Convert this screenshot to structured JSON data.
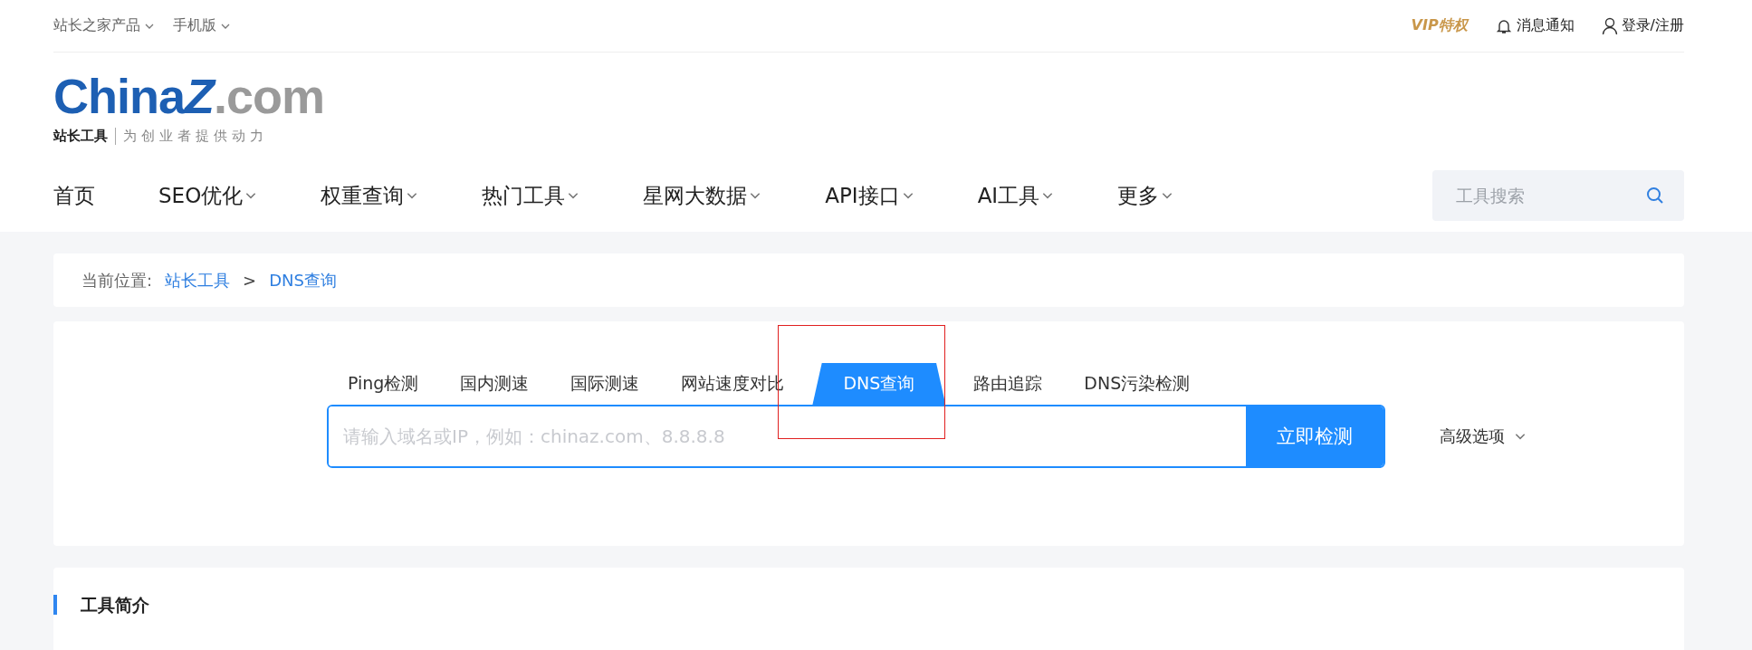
{
  "top_bar": {
    "left_links": [
      {
        "label": "站长之家产品",
        "dropdown": true
      },
      {
        "label": "手机版",
        "dropdown": true
      }
    ],
    "vip": "VIP特权",
    "notifications": "消息通知",
    "login": "登录/注册"
  },
  "logo": {
    "main": "China",
    "mark": "Z",
    "suffix": ".com",
    "brand": "站长工具",
    "slogan": "为创业者提供动力"
  },
  "nav": [
    {
      "label": "首页",
      "dropdown": false
    },
    {
      "label": "SEO优化",
      "dropdown": true
    },
    {
      "label": "权重查询",
      "dropdown": true
    },
    {
      "label": "热门工具",
      "dropdown": true
    },
    {
      "label": "星网大数据",
      "dropdown": true
    },
    {
      "label": "API接口",
      "dropdown": true
    },
    {
      "label": "AI工具",
      "dropdown": true
    },
    {
      "label": "更多",
      "dropdown": true
    }
  ],
  "search": {
    "placeholder": "工具搜索"
  },
  "breadcrumb": {
    "label": "当前位置:",
    "items": [
      "站长工具",
      "DNS查询"
    ],
    "separator": ">"
  },
  "tabs": [
    {
      "label": "Ping检测",
      "selected": false,
      "highlighted": false
    },
    {
      "label": "国内测速",
      "selected": false,
      "highlighted": false
    },
    {
      "label": "国际测速",
      "selected": false,
      "highlighted": false
    },
    {
      "label": "网站速度对比",
      "selected": false,
      "highlighted": false
    },
    {
      "label": "DNS查询",
      "selected": true,
      "highlighted": true
    },
    {
      "label": "路由追踪",
      "selected": false,
      "highlighted": false
    },
    {
      "label": "DNS污染检测",
      "selected": false,
      "highlighted": false
    }
  ],
  "query": {
    "placeholder": "请输入域名或IP，例如：chinaz.com、8.8.8.8",
    "button": "立即检测",
    "advanced": "高级选项"
  },
  "intro": {
    "title": "工具简介"
  }
}
